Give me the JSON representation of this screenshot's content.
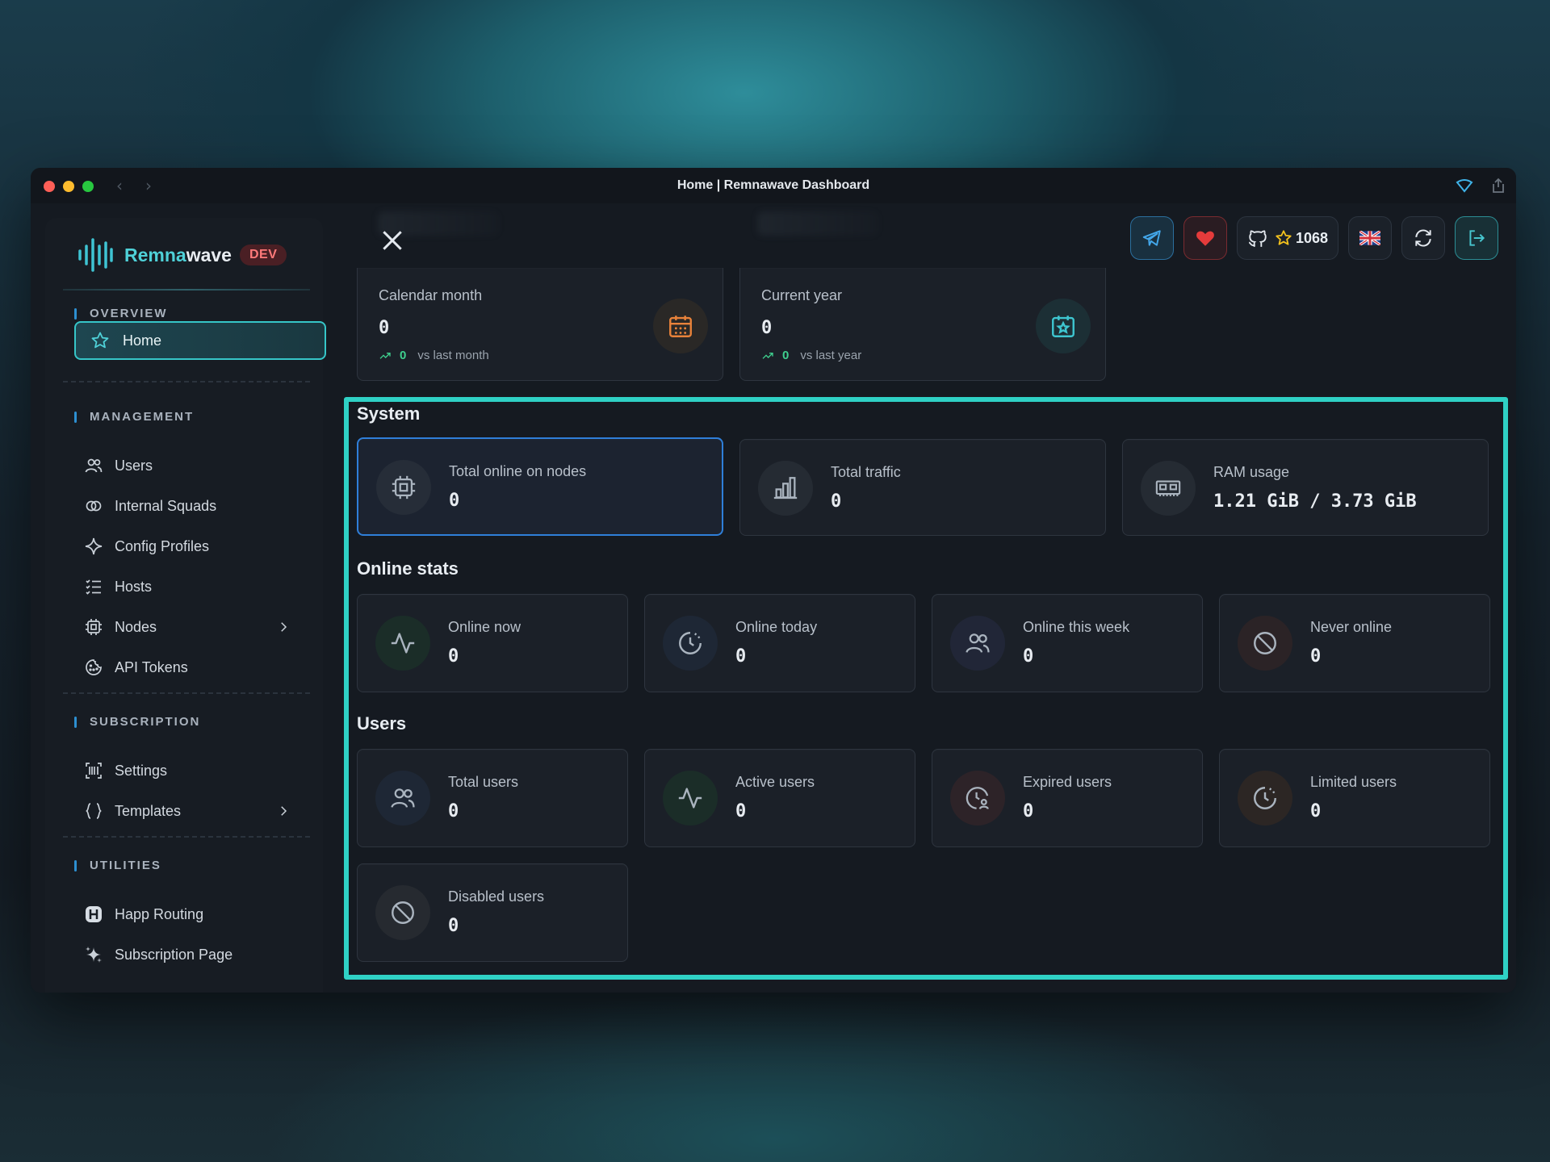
{
  "window": {
    "title": "Home | Remnawave Dashboard"
  },
  "brand": {
    "name_a": "Remna",
    "name_b": "wave",
    "badge": "DEV"
  },
  "sidebar": {
    "sections": {
      "overview": "OVERVIEW",
      "management": "MANAGEMENT",
      "subscription": "SUBSCRIPTION",
      "utilities": "UTILITIES"
    },
    "home": "Home",
    "management_items": [
      {
        "label": "Users",
        "icon": "users-icon"
      },
      {
        "label": "Internal Squads",
        "icon": "circles-icon"
      },
      {
        "label": "Config Profiles",
        "icon": "sparkle-icon"
      },
      {
        "label": "Hosts",
        "icon": "list-icon"
      },
      {
        "label": "Nodes",
        "icon": "cpu-icon"
      },
      {
        "label": "API Tokens",
        "icon": "cookie-icon"
      }
    ],
    "subscription_items": [
      {
        "label": "Settings",
        "icon": "barcode-icon"
      },
      {
        "label": "Templates",
        "icon": "braces-icon"
      }
    ],
    "utilities_items": [
      {
        "label": "Happ Routing",
        "icon": "happ-icon"
      },
      {
        "label": "Subscription Page",
        "icon": "sparkles-icon"
      }
    ]
  },
  "topbar": {
    "github_stars": "1068",
    "flag": "UK"
  },
  "period_cards": [
    {
      "label": "Calendar month",
      "value": "0",
      "trend_value": "0",
      "trend_text": "vs last month",
      "icon": "calendar-icon",
      "color": "#e8823a"
    },
    {
      "label": "Current year",
      "value": "0",
      "trend_value": "0",
      "trend_text": "vs last year",
      "icon": "calendar-star-icon",
      "color": "#3ec6d0"
    }
  ],
  "system": {
    "title": "System",
    "cards": [
      {
        "label": "Total online on nodes",
        "value": "0",
        "icon": "cpu-icon"
      },
      {
        "label": "Total traffic",
        "value": "0",
        "icon": "bar-chart-icon"
      },
      {
        "label": "RAM usage",
        "value": "1.21 GiB / 3.73 GiB",
        "icon": "ram-icon"
      }
    ]
  },
  "online_stats": {
    "title": "Online stats",
    "cards": [
      {
        "label": "Online now",
        "value": "0",
        "icon": "activity-icon"
      },
      {
        "label": "Online today",
        "value": "0",
        "icon": "clock-pie-icon"
      },
      {
        "label": "Online this week",
        "value": "0",
        "icon": "users-icon"
      },
      {
        "label": "Never online",
        "value": "0",
        "icon": "ban-icon"
      }
    ]
  },
  "users": {
    "title": "Users",
    "cards": [
      {
        "label": "Total users",
        "value": "0",
        "icon": "users-icon"
      },
      {
        "label": "Active users",
        "value": "0",
        "icon": "activity-icon"
      },
      {
        "label": "Expired users",
        "value": "0",
        "icon": "clock-user-icon"
      },
      {
        "label": "Limited users",
        "value": "0",
        "icon": "clock-pie-icon"
      },
      {
        "label": "Disabled users",
        "value": "0",
        "icon": "ban-icon"
      }
    ]
  }
}
